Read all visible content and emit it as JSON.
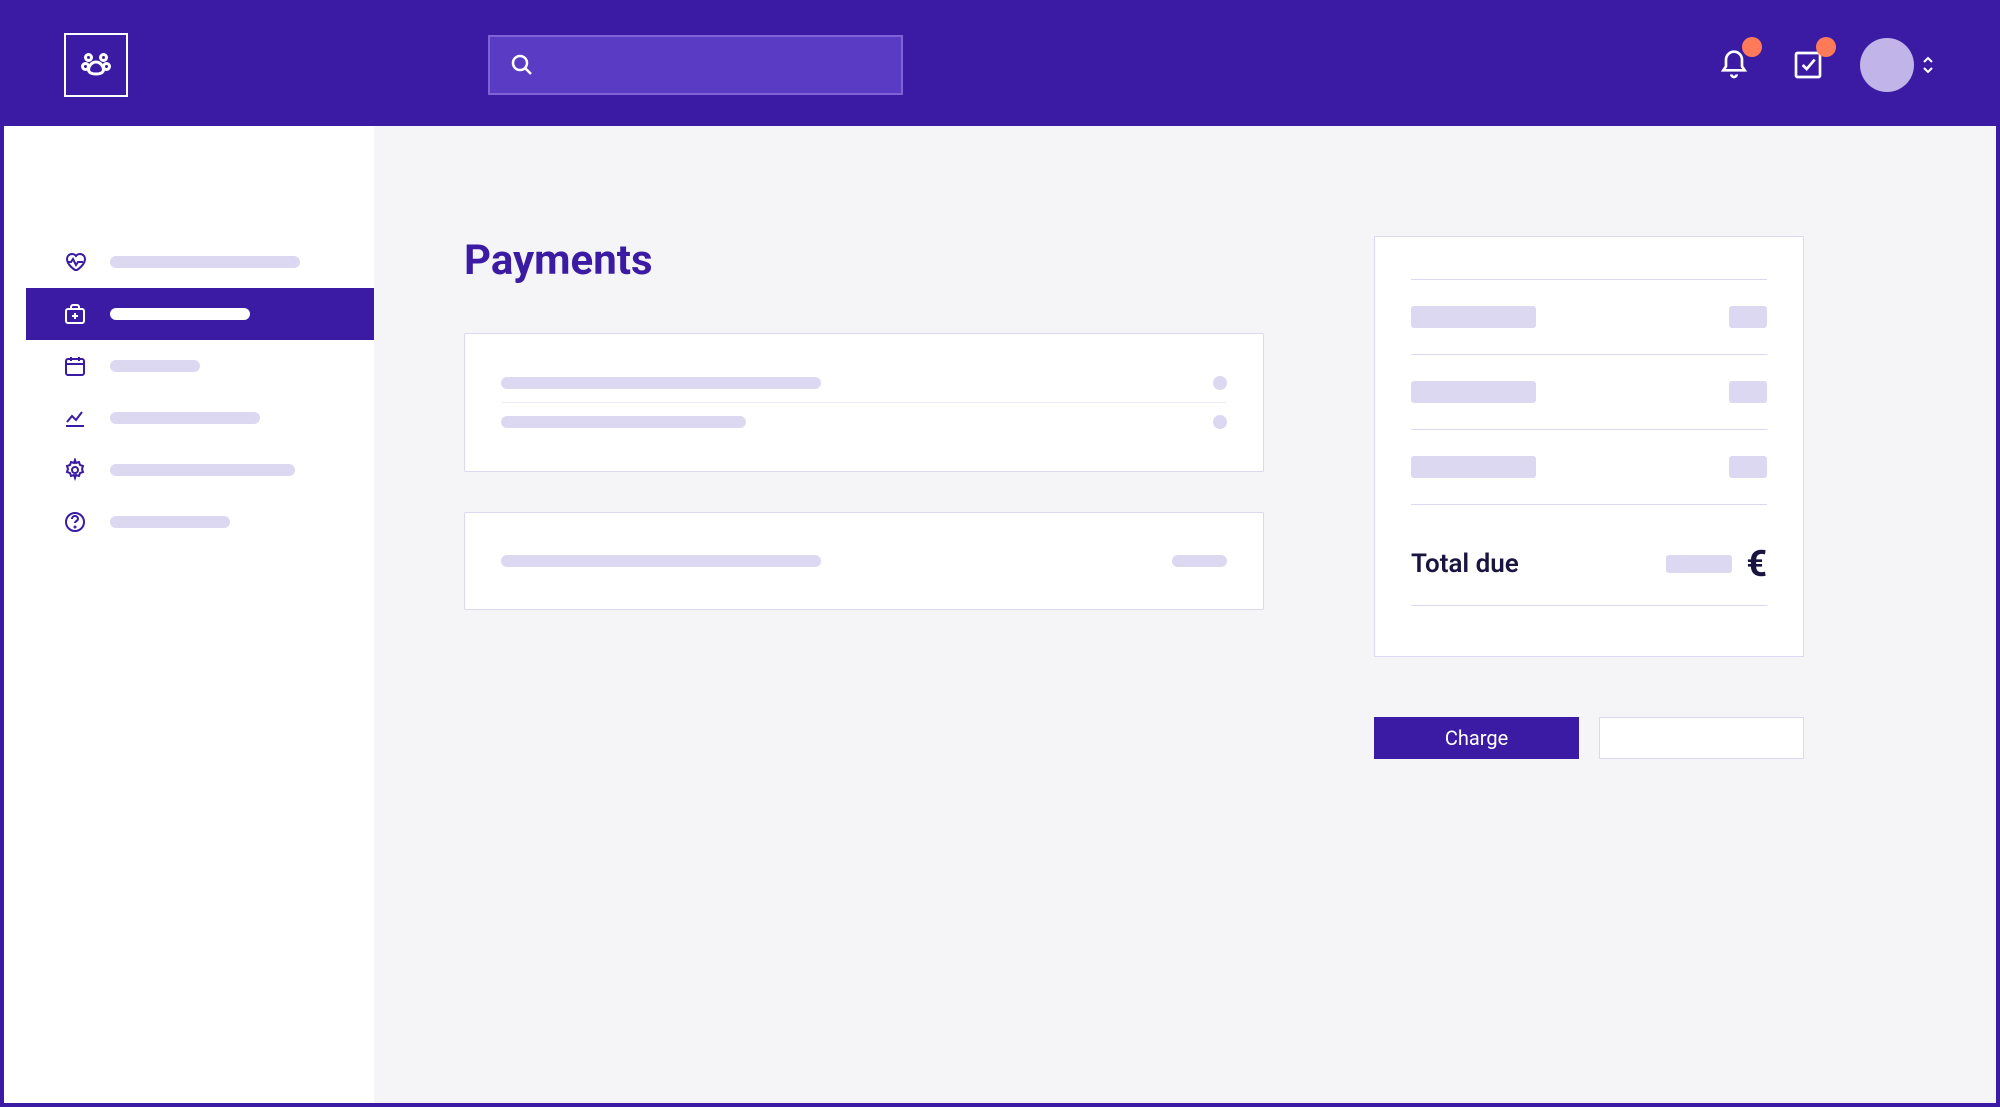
{
  "page": {
    "title": "Payments"
  },
  "summary": {
    "total_label": "Total due",
    "currency_symbol": "€"
  },
  "actions": {
    "charge_label": "Charge",
    "secondary_label": ""
  }
}
